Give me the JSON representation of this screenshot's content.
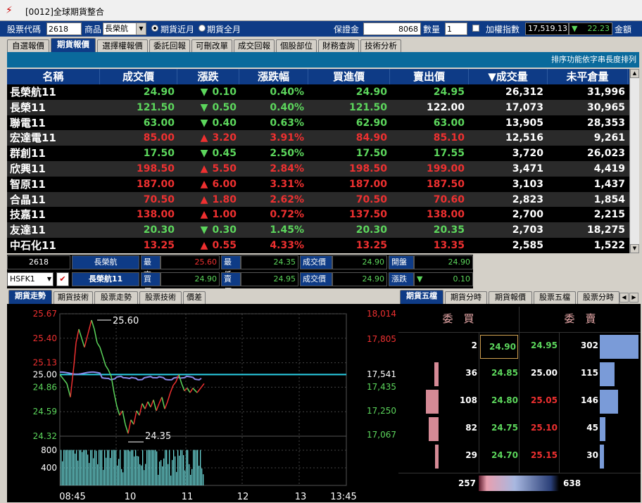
{
  "window": {
    "title": "[0012]全球期貨整合"
  },
  "toolbar": {
    "stock_code_label": "股票代碼",
    "stock_code_value": "2618",
    "product_label": "商品",
    "product_value": "長榮航",
    "near_month_label": "期貨近月",
    "all_month_label": "期貨全月",
    "margin_label": "保證金",
    "margin_value": "8068",
    "qty_label": "數量",
    "qty_value": "1",
    "weighted_index_label": "加權指數",
    "weighted_index_value": "17,519.13",
    "weighted_index_change": "22.23",
    "amount_label": "金額(億"
  },
  "main_tabs": [
    {
      "label": "自選報價",
      "active": false
    },
    {
      "label": "期貨報價",
      "active": true
    },
    {
      "label": "選擇權報價",
      "active": false
    },
    {
      "label": "委託回報",
      "active": false
    },
    {
      "label": "可刪改單",
      "active": false
    },
    {
      "label": "成交回報",
      "active": false
    },
    {
      "label": "個股部位",
      "active": false
    },
    {
      "label": "財務查詢",
      "active": false
    },
    {
      "label": "技術分析",
      "active": false
    }
  ],
  "info_text": "排序功能依字串長度排列",
  "quote_headers": [
    "名稱",
    "成交價",
    "漲跌",
    "漲跌幅",
    "買進價",
    "賣出價",
    "▼成交量",
    "未平倉量"
  ],
  "quotes": [
    {
      "name": "長榮航11",
      "price": "24.90",
      "dir": "down",
      "chg": "0.10",
      "pct": "0.40%",
      "bid": "24.90",
      "ask": "24.95",
      "vol": "26,312",
      "oi": "31,996",
      "color": "green",
      "ask_color": "green"
    },
    {
      "name": "長榮11",
      "price": "121.50",
      "dir": "down",
      "chg": "0.50",
      "pct": "0.40%",
      "bid": "121.50",
      "ask": "122.00",
      "vol": "17,073",
      "oi": "30,965",
      "color": "green",
      "ask_color": "white"
    },
    {
      "name": "聯電11",
      "price": "63.00",
      "dir": "down",
      "chg": "0.40",
      "pct": "0.63%",
      "bid": "62.90",
      "ask": "63.00",
      "vol": "13,905",
      "oi": "28,353",
      "color": "green",
      "ask_color": "green"
    },
    {
      "name": "宏達電11",
      "price": "85.00",
      "dir": "up",
      "chg": "3.20",
      "pct": "3.91%",
      "bid": "84.90",
      "ask": "85.10",
      "vol": "12,516",
      "oi": "9,261",
      "color": "red",
      "ask_color": "red"
    },
    {
      "name": "群創11",
      "price": "17.50",
      "dir": "down",
      "chg": "0.45",
      "pct": "2.50%",
      "bid": "17.50",
      "ask": "17.55",
      "vol": "3,720",
      "oi": "26,023",
      "color": "green",
      "ask_color": "green"
    },
    {
      "name": "欣興11",
      "price": "198.50",
      "dir": "up",
      "chg": "5.50",
      "pct": "2.84%",
      "bid": "198.50",
      "ask": "199.00",
      "vol": "3,471",
      "oi": "4,419",
      "color": "red",
      "ask_color": "red"
    },
    {
      "name": "智原11",
      "price": "187.00",
      "dir": "up",
      "chg": "6.00",
      "pct": "3.31%",
      "bid": "187.00",
      "ask": "187.50",
      "vol": "3,103",
      "oi": "1,437",
      "color": "red",
      "ask_color": "red"
    },
    {
      "name": "合晶11",
      "price": "70.50",
      "dir": "up",
      "chg": "1.80",
      "pct": "2.62%",
      "bid": "70.50",
      "ask": "70.60",
      "vol": "2,823",
      "oi": "1,854",
      "color": "red",
      "ask_color": "red"
    },
    {
      "name": "技嘉11",
      "price": "138.00",
      "dir": "up",
      "chg": "1.00",
      "pct": "0.72%",
      "bid": "137.50",
      "ask": "138.00",
      "vol": "2,700",
      "oi": "2,215",
      "color": "red",
      "ask_color": "red"
    },
    {
      "name": "友達11",
      "price": "20.30",
      "dir": "down",
      "chg": "0.30",
      "pct": "1.45%",
      "bid": "20.30",
      "ask": "20.35",
      "vol": "2,703",
      "oi": "18,275",
      "color": "green",
      "ask_color": "green"
    },
    {
      "name": "中石化11",
      "price": "13.25",
      "dir": "up",
      "chg": "0.55",
      "pct": "4.33%",
      "bid": "13.25",
      "ask": "13.35",
      "vol": "2,585",
      "oi": "1,522",
      "color": "red",
      "ask_color": "red"
    }
  ],
  "detail": {
    "code": "2618",
    "name1": "長榮航",
    "name2": "長榮航11",
    "contract": "HSFK1",
    "high_label": "最高",
    "high": "25.60",
    "low_label": "最低",
    "low": "24.35",
    "last_label": "成交價",
    "last": "24.90",
    "open_label": "開盤",
    "open": "24.90",
    "bid_label": "買價",
    "bid": "24.90",
    "ask_label": "賣價",
    "ask": "24.95",
    "last2_label": "成交價",
    "last2": "24.90",
    "chg_label": "漲跌",
    "chg": "0.10"
  },
  "chart_tabs": [
    {
      "label": "期貨走勢",
      "active": true
    },
    {
      "label": "期貨技術",
      "active": false
    },
    {
      "label": "股票走勢",
      "active": false
    },
    {
      "label": "股票技術",
      "active": false
    },
    {
      "label": "價差",
      "active": false
    }
  ],
  "book_tabs": [
    {
      "label": "期貨五檔",
      "active": true
    },
    {
      "label": "期貨分時",
      "active": false
    },
    {
      "label": "期貨報價",
      "active": false
    },
    {
      "label": "股票五檔",
      "active": false
    },
    {
      "label": "股票分時",
      "active": false
    }
  ],
  "chart_data": {
    "type": "line",
    "x_ticks": [
      "08:45",
      "10",
      "11",
      "12",
      "13",
      "13:45"
    ],
    "y_left_ticks": [
      "25.67",
      "25.40",
      "25.13",
      "25.00",
      "24.86",
      "24.59",
      "24.32"
    ],
    "y_right_ticks": [
      "18,014",
      "17,805",
      "17,541",
      "17,435",
      "17,250",
      "17,067"
    ],
    "volume_ticks": [
      "800",
      "400"
    ],
    "reference_price": 25.0,
    "high_annotation": "25.60",
    "low_annotation": "24.35",
    "ylim": [
      24.32,
      25.67
    ],
    "colors": {
      "price_up": "#ee3030",
      "price_down": "#5cd65c",
      "index": "#8a8ae8",
      "volume": "#6cd6d6",
      "ref": "#2ad0e6"
    }
  },
  "order_book": {
    "buy_header": "委　買",
    "sell_header": "委　賣",
    "rows": [
      {
        "bid_qty": "2",
        "bid": "24.90",
        "ask": "24.95",
        "ask_qty": "302",
        "bid_frac": 0.0,
        "ask_frac": 1.0,
        "ask_color": "green"
      },
      {
        "bid_qty": "36",
        "bid": "24.85",
        "ask": "25.00",
        "ask_qty": "115",
        "bid_frac": 0.33,
        "ask_frac": 0.38,
        "ask_color": "white"
      },
      {
        "bid_qty": "108",
        "bid": "24.80",
        "ask": "25.05",
        "ask_qty": "146",
        "bid_frac": 1.0,
        "ask_frac": 0.48,
        "ask_color": "red"
      },
      {
        "bid_qty": "82",
        "bid": "24.75",
        "ask": "25.10",
        "ask_qty": "45",
        "bid_frac": 0.76,
        "ask_frac": 0.15,
        "ask_color": "red"
      },
      {
        "bid_qty": "29",
        "bid": "24.70",
        "ask": "25.15",
        "ask_qty": "30",
        "bid_frac": 0.27,
        "ask_frac": 0.1,
        "ask_color": "red"
      }
    ],
    "total_bid": "257",
    "total_ask": "638"
  }
}
